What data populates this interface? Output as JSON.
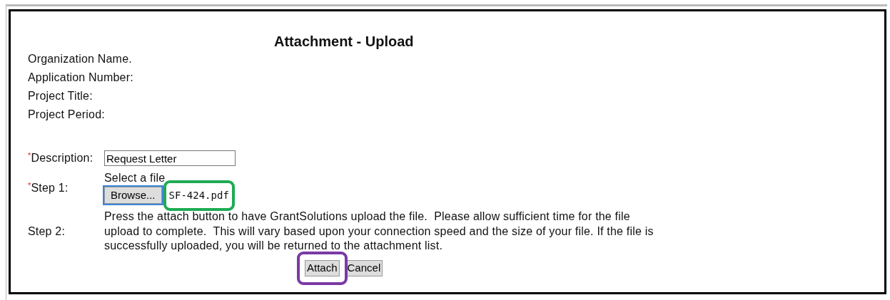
{
  "title": "Attachment - Upload",
  "info_labels": [
    "Organization Name.",
    "Application Number:",
    "Project Title:",
    "Project Period:"
  ],
  "required_mark": "*",
  "description": {
    "label": "Description:",
    "required": true,
    "value": "Request Letter"
  },
  "step1": {
    "label": "Step 1:",
    "required": true,
    "hint": "Select a file",
    "browse_button": "Browse...",
    "file_name": "SF-424.pdf",
    "browse_focused": true
  },
  "step2": {
    "label": "Step 2:",
    "required": false,
    "text": "Press the attach button to have GrantSolutions upload the file.  Please allow sufficient time for the file upload to complete.  This will vary based upon your connection speed and the size of your file. If the file is successfully uploaded, you will be returned to the attachment list."
  },
  "buttons": [
    "Attach",
    "Cancel"
  ],
  "annotations": [
    {
      "kind": "file",
      "color": "#1eab55"
    },
    {
      "kind": "attach",
      "color": "#7a3aa6"
    }
  ]
}
